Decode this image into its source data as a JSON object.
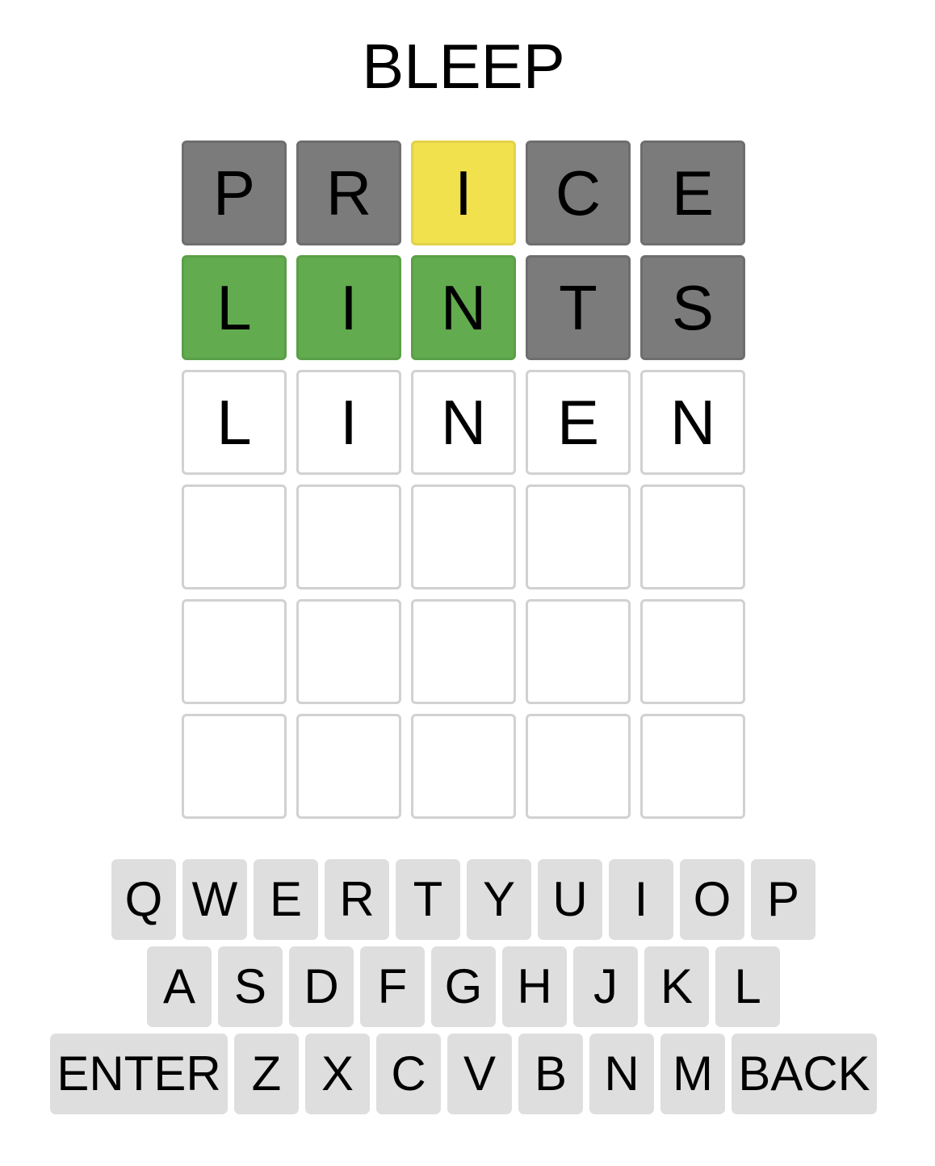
{
  "header": {
    "title": "BLEEP"
  },
  "board": {
    "rows": [
      [
        {
          "letter": "P",
          "state": "absent"
        },
        {
          "letter": "R",
          "state": "absent"
        },
        {
          "letter": "I",
          "state": "present"
        },
        {
          "letter": "C",
          "state": "absent"
        },
        {
          "letter": "E",
          "state": "absent"
        }
      ],
      [
        {
          "letter": "L",
          "state": "correct"
        },
        {
          "letter": "I",
          "state": "correct"
        },
        {
          "letter": "N",
          "state": "correct"
        },
        {
          "letter": "T",
          "state": "absent"
        },
        {
          "letter": "S",
          "state": "absent"
        }
      ],
      [
        {
          "letter": "L",
          "state": "empty"
        },
        {
          "letter": "I",
          "state": "empty"
        },
        {
          "letter": "N",
          "state": "empty"
        },
        {
          "letter": "E",
          "state": "empty"
        },
        {
          "letter": "N",
          "state": "empty"
        }
      ],
      [
        {
          "letter": "",
          "state": "empty"
        },
        {
          "letter": "",
          "state": "empty"
        },
        {
          "letter": "",
          "state": "empty"
        },
        {
          "letter": "",
          "state": "empty"
        },
        {
          "letter": "",
          "state": "empty"
        }
      ],
      [
        {
          "letter": "",
          "state": "empty"
        },
        {
          "letter": "",
          "state": "empty"
        },
        {
          "letter": "",
          "state": "empty"
        },
        {
          "letter": "",
          "state": "empty"
        },
        {
          "letter": "",
          "state": "empty"
        }
      ],
      [
        {
          "letter": "",
          "state": "empty"
        },
        {
          "letter": "",
          "state": "empty"
        },
        {
          "letter": "",
          "state": "empty"
        },
        {
          "letter": "",
          "state": "empty"
        },
        {
          "letter": "",
          "state": "empty"
        }
      ]
    ]
  },
  "keyboard": {
    "rows": [
      [
        "Q",
        "W",
        "E",
        "R",
        "T",
        "Y",
        "U",
        "I",
        "O",
        "P"
      ],
      [
        "A",
        "S",
        "D",
        "F",
        "G",
        "H",
        "J",
        "K",
        "L"
      ],
      [
        "ENTER",
        "Z",
        "X",
        "C",
        "V",
        "B",
        "N",
        "M",
        "BACK"
      ]
    ]
  },
  "colors": {
    "absent": "#7b7b7b",
    "present": "#f0e14d",
    "correct": "#62ab4f",
    "empty_border": "#d1d1d1",
    "key_background": "#dedede"
  }
}
